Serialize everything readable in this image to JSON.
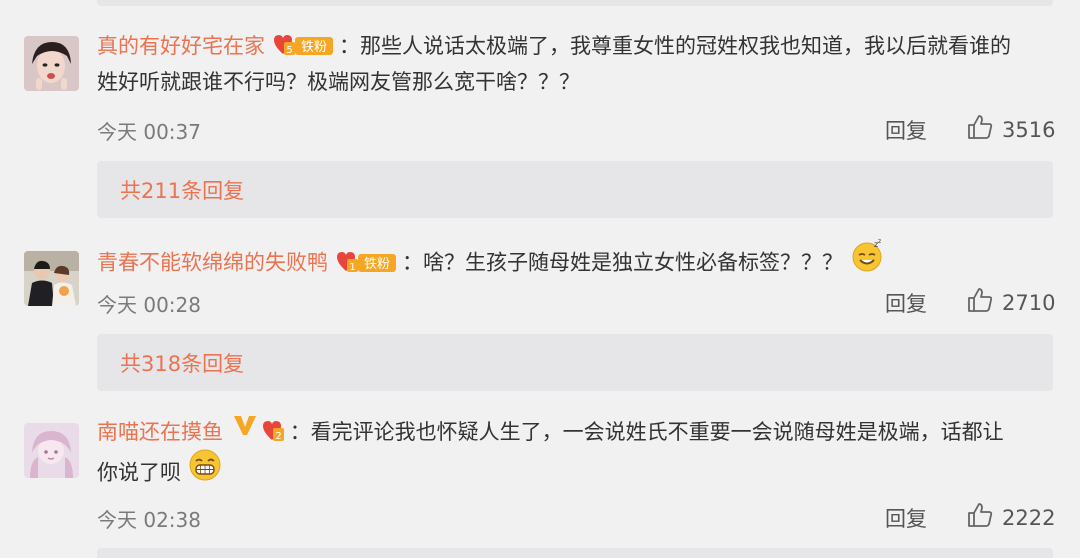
{
  "comments": [
    {
      "username": "真的有好好宅在家",
      "badge_text": "铁粉",
      "badge_level": "5",
      "content_line1": "：那些人说话太极端了，我尊重女性的冠姓权我也知道，我以后就看谁的",
      "content_line2": "姓好听就跟谁不行吗？极端网友管那么宽干啥？？？",
      "time": "今天 00:37",
      "reply_label": "回复",
      "likes": "3516",
      "replies_summary": "共211条回复"
    },
    {
      "username": "青春不能软绵绵的失败鸭",
      "badge_text": "铁粉",
      "badge_level": "1",
      "content_line1": "：啥？生孩子随母姓是独立女性必备标签？？？",
      "time": "今天 00:28",
      "reply_label": "回复",
      "likes": "2710",
      "replies_summary": "共318条回复"
    },
    {
      "username": "南喵还在摸鱼",
      "badge_level": "2",
      "content_line1": "：看完评论我也怀疑人生了，一会说姓氏不重要一会说随母姓是极端，话都让",
      "content_line2": "你说了呗",
      "time": "今天 02:38",
      "reply_label": "回复",
      "likes": "2222"
    }
  ],
  "colors": {
    "username": "#eb7350",
    "background": "#f1f1f2",
    "reply_box": "#e6e6e8",
    "badge": "#f5a623"
  }
}
